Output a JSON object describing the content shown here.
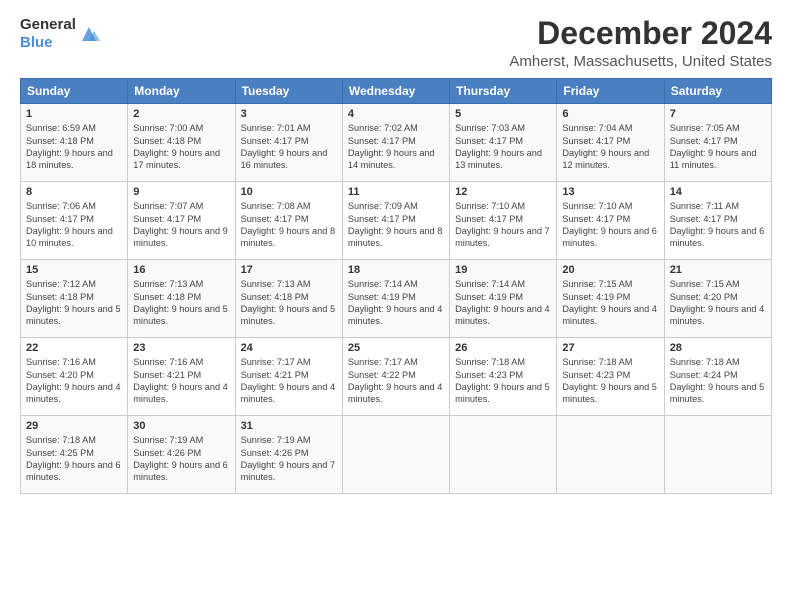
{
  "logo": {
    "general": "General",
    "blue": "Blue"
  },
  "title": "December 2024",
  "subtitle": "Amherst, Massachusetts, United States",
  "weekdays": [
    "Sunday",
    "Monday",
    "Tuesday",
    "Wednesday",
    "Thursday",
    "Friday",
    "Saturday"
  ],
  "weeks": [
    [
      {
        "day": "1",
        "sunrise": "Sunrise: 6:59 AM",
        "sunset": "Sunset: 4:18 PM",
        "daylight": "Daylight: 9 hours and 18 minutes."
      },
      {
        "day": "2",
        "sunrise": "Sunrise: 7:00 AM",
        "sunset": "Sunset: 4:18 PM",
        "daylight": "Daylight: 9 hours and 17 minutes."
      },
      {
        "day": "3",
        "sunrise": "Sunrise: 7:01 AM",
        "sunset": "Sunset: 4:17 PM",
        "daylight": "Daylight: 9 hours and 16 minutes."
      },
      {
        "day": "4",
        "sunrise": "Sunrise: 7:02 AM",
        "sunset": "Sunset: 4:17 PM",
        "daylight": "Daylight: 9 hours and 14 minutes."
      },
      {
        "day": "5",
        "sunrise": "Sunrise: 7:03 AM",
        "sunset": "Sunset: 4:17 PM",
        "daylight": "Daylight: 9 hours and 13 minutes."
      },
      {
        "day": "6",
        "sunrise": "Sunrise: 7:04 AM",
        "sunset": "Sunset: 4:17 PM",
        "daylight": "Daylight: 9 hours and 12 minutes."
      },
      {
        "day": "7",
        "sunrise": "Sunrise: 7:05 AM",
        "sunset": "Sunset: 4:17 PM",
        "daylight": "Daylight: 9 hours and 11 minutes."
      }
    ],
    [
      {
        "day": "8",
        "sunrise": "Sunrise: 7:06 AM",
        "sunset": "Sunset: 4:17 PM",
        "daylight": "Daylight: 9 hours and 10 minutes."
      },
      {
        "day": "9",
        "sunrise": "Sunrise: 7:07 AM",
        "sunset": "Sunset: 4:17 PM",
        "daylight": "Daylight: 9 hours and 9 minutes."
      },
      {
        "day": "10",
        "sunrise": "Sunrise: 7:08 AM",
        "sunset": "Sunset: 4:17 PM",
        "daylight": "Daylight: 9 hours and 8 minutes."
      },
      {
        "day": "11",
        "sunrise": "Sunrise: 7:09 AM",
        "sunset": "Sunset: 4:17 PM",
        "daylight": "Daylight: 9 hours and 8 minutes."
      },
      {
        "day": "12",
        "sunrise": "Sunrise: 7:10 AM",
        "sunset": "Sunset: 4:17 PM",
        "daylight": "Daylight: 9 hours and 7 minutes."
      },
      {
        "day": "13",
        "sunrise": "Sunrise: 7:10 AM",
        "sunset": "Sunset: 4:17 PM",
        "daylight": "Daylight: 9 hours and 6 minutes."
      },
      {
        "day": "14",
        "sunrise": "Sunrise: 7:11 AM",
        "sunset": "Sunset: 4:17 PM",
        "daylight": "Daylight: 9 hours and 6 minutes."
      }
    ],
    [
      {
        "day": "15",
        "sunrise": "Sunrise: 7:12 AM",
        "sunset": "Sunset: 4:18 PM",
        "daylight": "Daylight: 9 hours and 5 minutes."
      },
      {
        "day": "16",
        "sunrise": "Sunrise: 7:13 AM",
        "sunset": "Sunset: 4:18 PM",
        "daylight": "Daylight: 9 hours and 5 minutes."
      },
      {
        "day": "17",
        "sunrise": "Sunrise: 7:13 AM",
        "sunset": "Sunset: 4:18 PM",
        "daylight": "Daylight: 9 hours and 5 minutes."
      },
      {
        "day": "18",
        "sunrise": "Sunrise: 7:14 AM",
        "sunset": "Sunset: 4:19 PM",
        "daylight": "Daylight: 9 hours and 4 minutes."
      },
      {
        "day": "19",
        "sunrise": "Sunrise: 7:14 AM",
        "sunset": "Sunset: 4:19 PM",
        "daylight": "Daylight: 9 hours and 4 minutes."
      },
      {
        "day": "20",
        "sunrise": "Sunrise: 7:15 AM",
        "sunset": "Sunset: 4:19 PM",
        "daylight": "Daylight: 9 hours and 4 minutes."
      },
      {
        "day": "21",
        "sunrise": "Sunrise: 7:15 AM",
        "sunset": "Sunset: 4:20 PM",
        "daylight": "Daylight: 9 hours and 4 minutes."
      }
    ],
    [
      {
        "day": "22",
        "sunrise": "Sunrise: 7:16 AM",
        "sunset": "Sunset: 4:20 PM",
        "daylight": "Daylight: 9 hours and 4 minutes."
      },
      {
        "day": "23",
        "sunrise": "Sunrise: 7:16 AM",
        "sunset": "Sunset: 4:21 PM",
        "daylight": "Daylight: 9 hours and 4 minutes."
      },
      {
        "day": "24",
        "sunrise": "Sunrise: 7:17 AM",
        "sunset": "Sunset: 4:21 PM",
        "daylight": "Daylight: 9 hours and 4 minutes."
      },
      {
        "day": "25",
        "sunrise": "Sunrise: 7:17 AM",
        "sunset": "Sunset: 4:22 PM",
        "daylight": "Daylight: 9 hours and 4 minutes."
      },
      {
        "day": "26",
        "sunrise": "Sunrise: 7:18 AM",
        "sunset": "Sunset: 4:23 PM",
        "daylight": "Daylight: 9 hours and 5 minutes."
      },
      {
        "day": "27",
        "sunrise": "Sunrise: 7:18 AM",
        "sunset": "Sunset: 4:23 PM",
        "daylight": "Daylight: 9 hours and 5 minutes."
      },
      {
        "day": "28",
        "sunrise": "Sunrise: 7:18 AM",
        "sunset": "Sunset: 4:24 PM",
        "daylight": "Daylight: 9 hours and 5 minutes."
      }
    ],
    [
      {
        "day": "29",
        "sunrise": "Sunrise: 7:18 AM",
        "sunset": "Sunset: 4:25 PM",
        "daylight": "Daylight: 9 hours and 6 minutes."
      },
      {
        "day": "30",
        "sunrise": "Sunrise: 7:19 AM",
        "sunset": "Sunset: 4:26 PM",
        "daylight": "Daylight: 9 hours and 6 minutes."
      },
      {
        "day": "31",
        "sunrise": "Sunrise: 7:19 AM",
        "sunset": "Sunset: 4:26 PM",
        "daylight": "Daylight: 9 hours and 7 minutes."
      },
      null,
      null,
      null,
      null
    ]
  ]
}
